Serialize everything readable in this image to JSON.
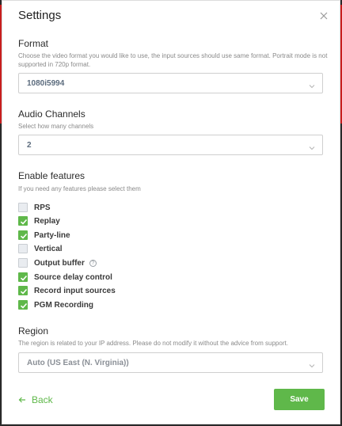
{
  "dialog": {
    "title": "Settings"
  },
  "format": {
    "title": "Format",
    "hint": "Choose the video format you would like to use, the input sources should use same format. Portrait mode is not supported in 720p format.",
    "value": "1080i5994"
  },
  "audio": {
    "title": "Audio Channels",
    "hint": "Select how many channels",
    "value": "2"
  },
  "features": {
    "title": "Enable features",
    "hint": "If you need any features please select them",
    "items": [
      {
        "label": "RPS",
        "checked": false
      },
      {
        "label": "Replay",
        "checked": true
      },
      {
        "label": "Party-line",
        "checked": true
      },
      {
        "label": "Vertical",
        "checked": false
      },
      {
        "label": "Output buffer",
        "checked": false
      },
      {
        "label": "Source delay control",
        "checked": true
      },
      {
        "label": "Record input sources",
        "checked": true
      },
      {
        "label": "PGM Recording",
        "checked": true
      }
    ]
  },
  "region": {
    "title": "Region",
    "hint": "The region is related to your IP address. Please do not modify it without the advice from support.",
    "value": "Auto (US East (N. Virginia))"
  },
  "footer": {
    "back_label": "Back",
    "save_label": "Save"
  },
  "colors": {
    "accent": "#5fb84a",
    "checkbox_off": "#e9ecf0"
  }
}
